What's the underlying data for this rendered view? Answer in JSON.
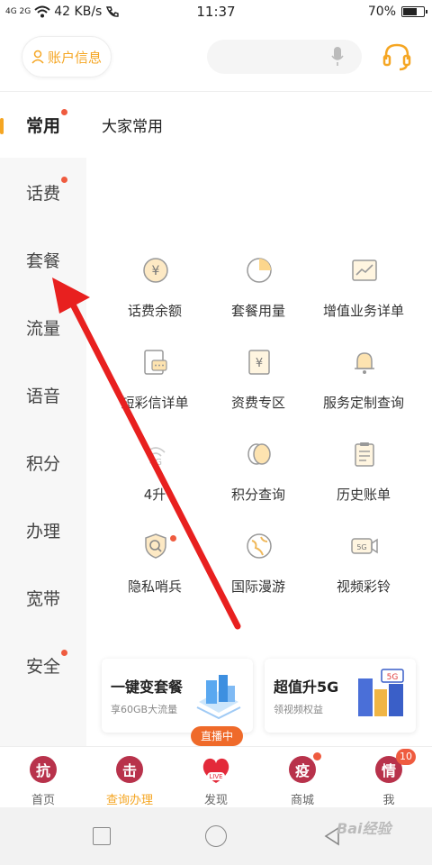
{
  "statusbar": {
    "signal": "4G 2G",
    "speed": "42 KB/s",
    "time": "11:37",
    "battery": "70%",
    "battery_level": 0.7
  },
  "header": {
    "account_label": "账户信息",
    "search_placeholder": ""
  },
  "sidebar": {
    "items": [
      {
        "label": "常用",
        "active": true,
        "dot": true
      },
      {
        "label": "话费",
        "active": false,
        "dot": true
      },
      {
        "label": "套餐",
        "active": false,
        "dot": false
      },
      {
        "label": "流量",
        "active": false,
        "dot": false
      },
      {
        "label": "语音",
        "active": false,
        "dot": false
      },
      {
        "label": "积分",
        "active": false,
        "dot": false
      },
      {
        "label": "办理",
        "active": false,
        "dot": false
      },
      {
        "label": "宽带",
        "active": false,
        "dot": false
      },
      {
        "label": "安全",
        "active": false,
        "dot": true
      }
    ]
  },
  "main": {
    "section_title": "大家常用",
    "grid": [
      {
        "label": "话费余额",
        "icon": "yuan-coin-icon"
      },
      {
        "label": "套餐用量",
        "icon": "pie-chart-icon"
      },
      {
        "label": "增值业务详单",
        "icon": "trend-chart-icon"
      },
      {
        "label": "短彩信详单",
        "icon": "message-icon"
      },
      {
        "label": "资费专区",
        "icon": "yuan-book-icon"
      },
      {
        "label": "服务定制查询",
        "icon": "bell-icon"
      },
      {
        "label": "4升",
        "icon": "4g-signal-icon"
      },
      {
        "label": "积分查询",
        "icon": "coins-icon"
      },
      {
        "label": "历史账单",
        "icon": "clipboard-icon"
      },
      {
        "label": "隐私哨兵",
        "icon": "shield-search-icon",
        "dot": true
      },
      {
        "label": "国际漫游",
        "icon": "globe-icon"
      },
      {
        "label": "视频彩铃",
        "icon": "5g-video-icon"
      }
    ],
    "promos": [
      {
        "title": "一键变套餐",
        "subtitle": "享60GB大流量"
      },
      {
        "title": "超值升5G",
        "subtitle": "领视频权益"
      }
    ]
  },
  "tabbar": {
    "live_badge": "直播中",
    "tabs": [
      {
        "label": "首页",
        "icon_char": "抗"
      },
      {
        "label": "查询办理",
        "icon_char": "击",
        "active": true
      },
      {
        "label": "发现",
        "icon_char": "LIVE"
      },
      {
        "label": "商城",
        "icon_char": "疫"
      },
      {
        "label": "我",
        "icon_char": "情",
        "badge": "10"
      }
    ]
  },
  "watermark": "Bai经验",
  "colors": {
    "accent": "#f5a623",
    "dot": "#ef5b3f",
    "tab_icon": "#b8324b",
    "arrow": "#e8201f"
  }
}
